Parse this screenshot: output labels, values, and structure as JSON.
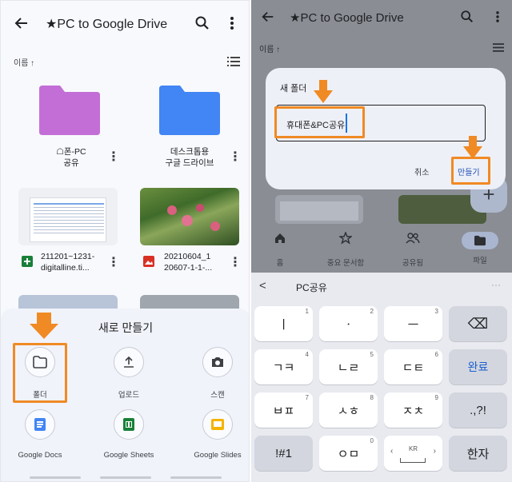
{
  "colors": {
    "accent_orange": "#f08a24",
    "folder_purple": "#c36ed6",
    "folder_blue": "#4285f4",
    "sheets_green": "#188038",
    "slides_yellow": "#f4b400",
    "docs_blue": "#4285f4",
    "image_red": "#d93025"
  },
  "left": {
    "back_icon": "arrow-left-icon",
    "title": "★PC to Google Drive",
    "search_icon": "search-icon",
    "more_icon": "more-vert-icon",
    "sort_label": "이름 ↑",
    "view_icon": "list-view-icon",
    "files": [
      {
        "type": "folder",
        "color": "purple",
        "name": "☖폰-PC\n공유"
      },
      {
        "type": "folder",
        "color": "blue",
        "name": "데스크톱용\n구글 드라이브"
      },
      {
        "type": "sheet",
        "name": "211201~1231-\ndigitalline.ti..."
      },
      {
        "type": "image",
        "name": "20210604_1\n20607-1-1-..."
      }
    ],
    "sheet": {
      "title": "새로 만들기",
      "options": [
        {
          "label": "폴더",
          "icon": "folder-icon"
        },
        {
          "label": "업로드",
          "icon": "upload-icon"
        },
        {
          "label": "스캔",
          "icon": "camera-icon"
        },
        {
          "label": "Google Docs",
          "icon": "docs-icon"
        },
        {
          "label": "Google Sheets",
          "icon": "sheets-icon"
        },
        {
          "label": "Google Slides",
          "icon": "slides-icon"
        }
      ]
    }
  },
  "right": {
    "back_icon": "arrow-left-icon",
    "title": "★PC to Google Drive",
    "search_icon": "search-icon",
    "more_icon": "more-vert-icon",
    "sort_label": "이름 ↑",
    "dialog": {
      "title": "새 폴더",
      "input_value": "휴대폰&PC공유",
      "cancel_label": "취소",
      "create_label": "만들기"
    },
    "nav": [
      {
        "label": "홈",
        "icon": "home-icon"
      },
      {
        "label": "중요 문서함",
        "icon": "star-icon"
      },
      {
        "label": "공유됨",
        "icon": "people-icon"
      },
      {
        "label": "파일",
        "icon": "folder-icon"
      }
    ],
    "suggestion_back": "<",
    "suggestion": "PC공유",
    "keyboard": {
      "rows": [
        [
          {
            "label": "ㅣ",
            "num": "1"
          },
          {
            "label": "ㆍ",
            "num": "2"
          },
          {
            "label": "ㅡ",
            "num": "3"
          },
          {
            "label": "⌫",
            "num": ""
          }
        ],
        [
          {
            "label": "ㄱㅋ",
            "num": "4"
          },
          {
            "label": "ㄴㄹ",
            "num": "5"
          },
          {
            "label": "ㄷㅌ",
            "num": "6"
          },
          {
            "label": "완료",
            "num": ""
          }
        ],
        [
          {
            "label": "ㅂㅍ",
            "num": "7"
          },
          {
            "label": "ㅅㅎ",
            "num": "8"
          },
          {
            "label": "ㅈㅊ",
            "num": "9"
          },
          {
            "label": ".,?!",
            "num": ""
          }
        ],
        [
          {
            "label": "!#1",
            "num": ""
          },
          {
            "label": "ㅇㅁ",
            "num": "0"
          },
          {
            "label": "KR",
            "num": ""
          },
          {
            "label": "한자",
            "num": ""
          }
        ]
      ]
    }
  }
}
